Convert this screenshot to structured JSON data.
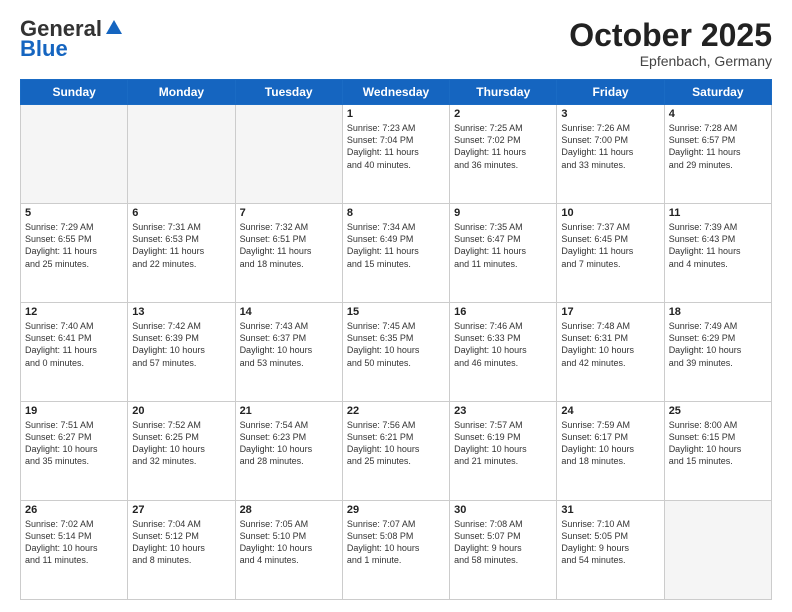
{
  "header": {
    "logo_general": "General",
    "logo_blue": "Blue",
    "month_title": "October 2025",
    "location": "Epfenbach, Germany"
  },
  "days_of_week": [
    "Sunday",
    "Monday",
    "Tuesday",
    "Wednesday",
    "Thursday",
    "Friday",
    "Saturday"
  ],
  "weeks": [
    [
      {
        "day": "",
        "info": ""
      },
      {
        "day": "",
        "info": ""
      },
      {
        "day": "",
        "info": ""
      },
      {
        "day": "1",
        "info": "Sunrise: 7:23 AM\nSunset: 7:04 PM\nDaylight: 11 hours\nand 40 minutes."
      },
      {
        "day": "2",
        "info": "Sunrise: 7:25 AM\nSunset: 7:02 PM\nDaylight: 11 hours\nand 36 minutes."
      },
      {
        "day": "3",
        "info": "Sunrise: 7:26 AM\nSunset: 7:00 PM\nDaylight: 11 hours\nand 33 minutes."
      },
      {
        "day": "4",
        "info": "Sunrise: 7:28 AM\nSunset: 6:57 PM\nDaylight: 11 hours\nand 29 minutes."
      }
    ],
    [
      {
        "day": "5",
        "info": "Sunrise: 7:29 AM\nSunset: 6:55 PM\nDaylight: 11 hours\nand 25 minutes."
      },
      {
        "day": "6",
        "info": "Sunrise: 7:31 AM\nSunset: 6:53 PM\nDaylight: 11 hours\nand 22 minutes."
      },
      {
        "day": "7",
        "info": "Sunrise: 7:32 AM\nSunset: 6:51 PM\nDaylight: 11 hours\nand 18 minutes."
      },
      {
        "day": "8",
        "info": "Sunrise: 7:34 AM\nSunset: 6:49 PM\nDaylight: 11 hours\nand 15 minutes."
      },
      {
        "day": "9",
        "info": "Sunrise: 7:35 AM\nSunset: 6:47 PM\nDaylight: 11 hours\nand 11 minutes."
      },
      {
        "day": "10",
        "info": "Sunrise: 7:37 AM\nSunset: 6:45 PM\nDaylight: 11 hours\nand 7 minutes."
      },
      {
        "day": "11",
        "info": "Sunrise: 7:39 AM\nSunset: 6:43 PM\nDaylight: 11 hours\nand 4 minutes."
      }
    ],
    [
      {
        "day": "12",
        "info": "Sunrise: 7:40 AM\nSunset: 6:41 PM\nDaylight: 11 hours\nand 0 minutes."
      },
      {
        "day": "13",
        "info": "Sunrise: 7:42 AM\nSunset: 6:39 PM\nDaylight: 10 hours\nand 57 minutes."
      },
      {
        "day": "14",
        "info": "Sunrise: 7:43 AM\nSunset: 6:37 PM\nDaylight: 10 hours\nand 53 minutes."
      },
      {
        "day": "15",
        "info": "Sunrise: 7:45 AM\nSunset: 6:35 PM\nDaylight: 10 hours\nand 50 minutes."
      },
      {
        "day": "16",
        "info": "Sunrise: 7:46 AM\nSunset: 6:33 PM\nDaylight: 10 hours\nand 46 minutes."
      },
      {
        "day": "17",
        "info": "Sunrise: 7:48 AM\nSunset: 6:31 PM\nDaylight: 10 hours\nand 42 minutes."
      },
      {
        "day": "18",
        "info": "Sunrise: 7:49 AM\nSunset: 6:29 PM\nDaylight: 10 hours\nand 39 minutes."
      }
    ],
    [
      {
        "day": "19",
        "info": "Sunrise: 7:51 AM\nSunset: 6:27 PM\nDaylight: 10 hours\nand 35 minutes."
      },
      {
        "day": "20",
        "info": "Sunrise: 7:52 AM\nSunset: 6:25 PM\nDaylight: 10 hours\nand 32 minutes."
      },
      {
        "day": "21",
        "info": "Sunrise: 7:54 AM\nSunset: 6:23 PM\nDaylight: 10 hours\nand 28 minutes."
      },
      {
        "day": "22",
        "info": "Sunrise: 7:56 AM\nSunset: 6:21 PM\nDaylight: 10 hours\nand 25 minutes."
      },
      {
        "day": "23",
        "info": "Sunrise: 7:57 AM\nSunset: 6:19 PM\nDaylight: 10 hours\nand 21 minutes."
      },
      {
        "day": "24",
        "info": "Sunrise: 7:59 AM\nSunset: 6:17 PM\nDaylight: 10 hours\nand 18 minutes."
      },
      {
        "day": "25",
        "info": "Sunrise: 8:00 AM\nSunset: 6:15 PM\nDaylight: 10 hours\nand 15 minutes."
      }
    ],
    [
      {
        "day": "26",
        "info": "Sunrise: 7:02 AM\nSunset: 5:14 PM\nDaylight: 10 hours\nand 11 minutes."
      },
      {
        "day": "27",
        "info": "Sunrise: 7:04 AM\nSunset: 5:12 PM\nDaylight: 10 hours\nand 8 minutes."
      },
      {
        "day": "28",
        "info": "Sunrise: 7:05 AM\nSunset: 5:10 PM\nDaylight: 10 hours\nand 4 minutes."
      },
      {
        "day": "29",
        "info": "Sunrise: 7:07 AM\nSunset: 5:08 PM\nDaylight: 10 hours\nand 1 minute."
      },
      {
        "day": "30",
        "info": "Sunrise: 7:08 AM\nSunset: 5:07 PM\nDaylight: 9 hours\nand 58 minutes."
      },
      {
        "day": "31",
        "info": "Sunrise: 7:10 AM\nSunset: 5:05 PM\nDaylight: 9 hours\nand 54 minutes."
      },
      {
        "day": "",
        "info": ""
      }
    ]
  ]
}
